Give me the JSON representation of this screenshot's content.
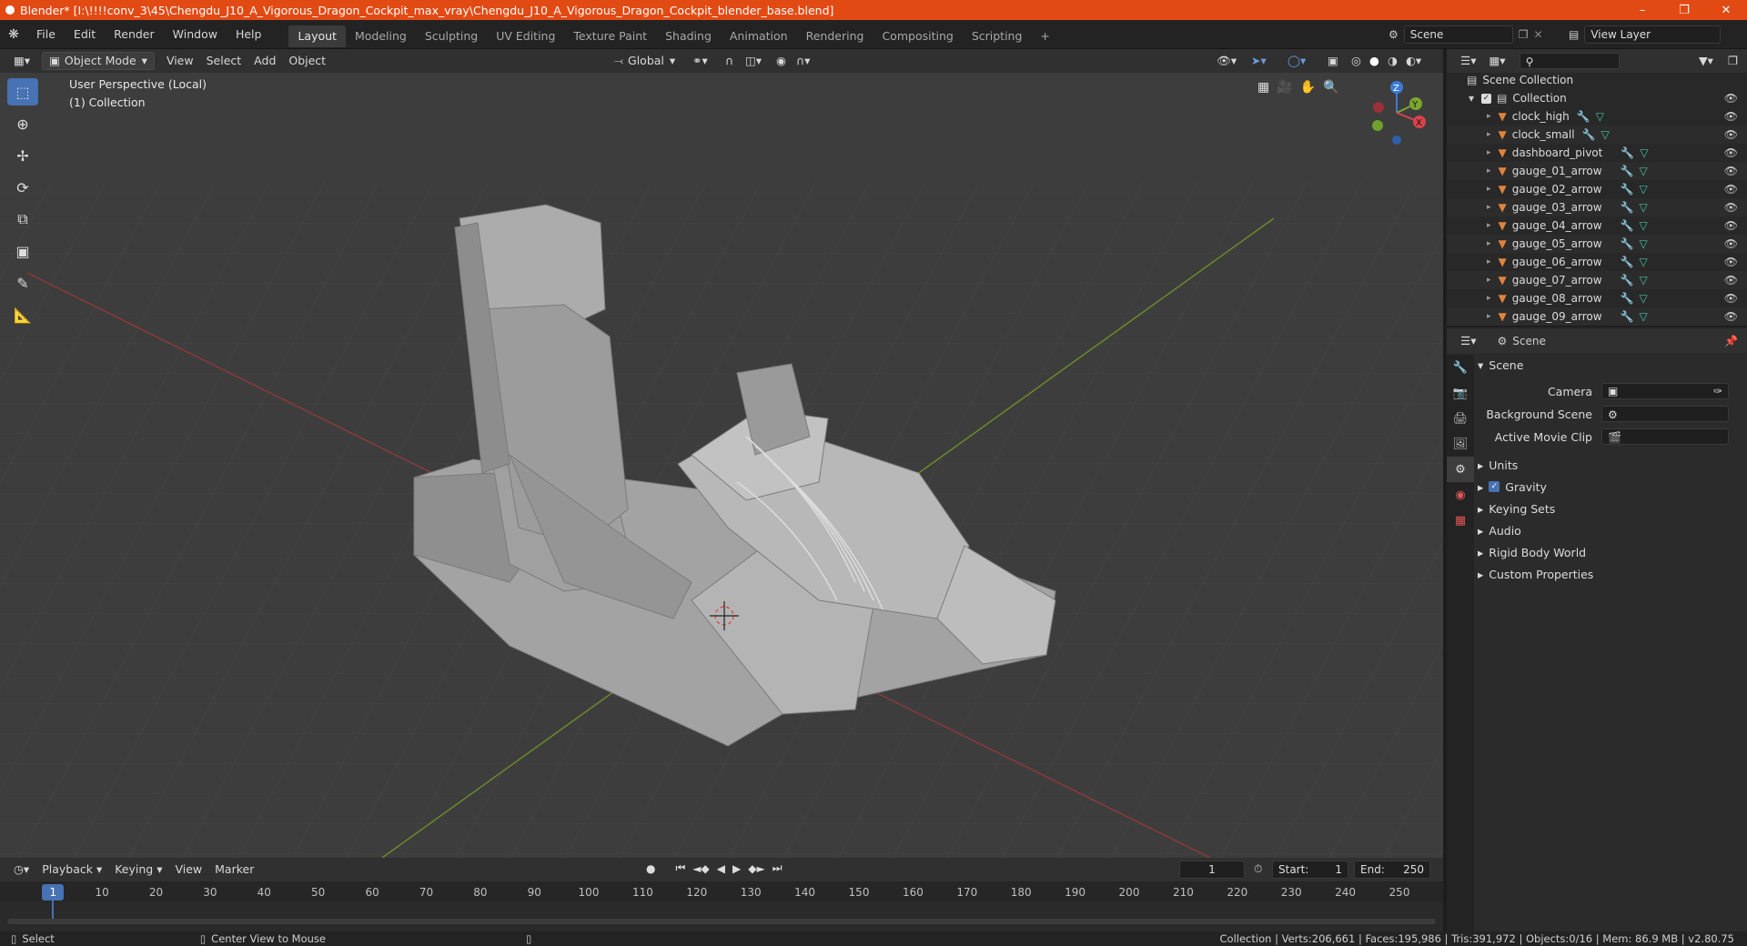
{
  "window": {
    "title": "Blender* [I:\\!!!!conv_3\\45\\Chengdu_J10_A_Vigorous_Dragon_Cockpit_max_vray\\Chengdu_J10_A_Vigorous_Dragon_Cockpit_blender_base.blend]"
  },
  "menu": [
    "File",
    "Edit",
    "Render",
    "Window",
    "Help"
  ],
  "workspaces": [
    "Layout",
    "Modeling",
    "Sculpting",
    "UV Editing",
    "Texture Paint",
    "Shading",
    "Animation",
    "Rendering",
    "Compositing",
    "Scripting"
  ],
  "scene_field": "Scene",
  "viewlayer_field": "View Layer",
  "viewport_header": {
    "mode": "Object Mode",
    "menus": [
      "View",
      "Select",
      "Add",
      "Object"
    ],
    "orientation": "Global"
  },
  "viewport": {
    "perspective": "User Perspective (Local)",
    "collection": "(1) Collection",
    "gizmo": {
      "x": "X",
      "y": "Y",
      "z": "Z"
    }
  },
  "outliner": {
    "root": "Scene Collection",
    "collection": "Collection",
    "items": [
      "clock_high",
      "clock_small",
      "dashboard_pivot",
      "gauge_01_arrow",
      "gauge_02_arrow",
      "gauge_03_arrow",
      "gauge_04_arrow",
      "gauge_05_arrow",
      "gauge_06_arrow",
      "gauge_07_arrow",
      "gauge_08_arrow",
      "gauge_09_arrow"
    ]
  },
  "properties": {
    "context": "Scene",
    "panel": "Scene",
    "camera_label": "Camera",
    "background_label": "Background Scene",
    "movieclip_label": "Active Movie Clip",
    "sections": [
      "Units",
      "Gravity",
      "Keying Sets",
      "Audio",
      "Rigid Body World",
      "Custom Properties"
    ],
    "gravity_checked": true
  },
  "timeline": {
    "menus": [
      "Playback",
      "Keying",
      "View",
      "Marker"
    ],
    "current_frame": "1",
    "start_label": "Start:",
    "start": "1",
    "end_label": "End:",
    "end": "250",
    "ticks": [
      "1",
      "10",
      "20",
      "30",
      "40",
      "50",
      "60",
      "70",
      "80",
      "90",
      "100",
      "110",
      "120",
      "130",
      "140",
      "150",
      "160",
      "170",
      "180",
      "190",
      "200",
      "210",
      "220",
      "230",
      "240",
      "250"
    ]
  },
  "status": {
    "select": "Select",
    "center": "Center View to Mouse",
    "stats": "Collection | Verts:206,661 | Faces:195,986 | Tris:391,972 | Objects:0/16 | Mem: 86.9 MB | v2.80.75"
  },
  "colors": {
    "titlebar": "#e24a14",
    "accent": "#4772b3",
    "mesh": "#3fc7a7",
    "object": "#e0843d"
  }
}
